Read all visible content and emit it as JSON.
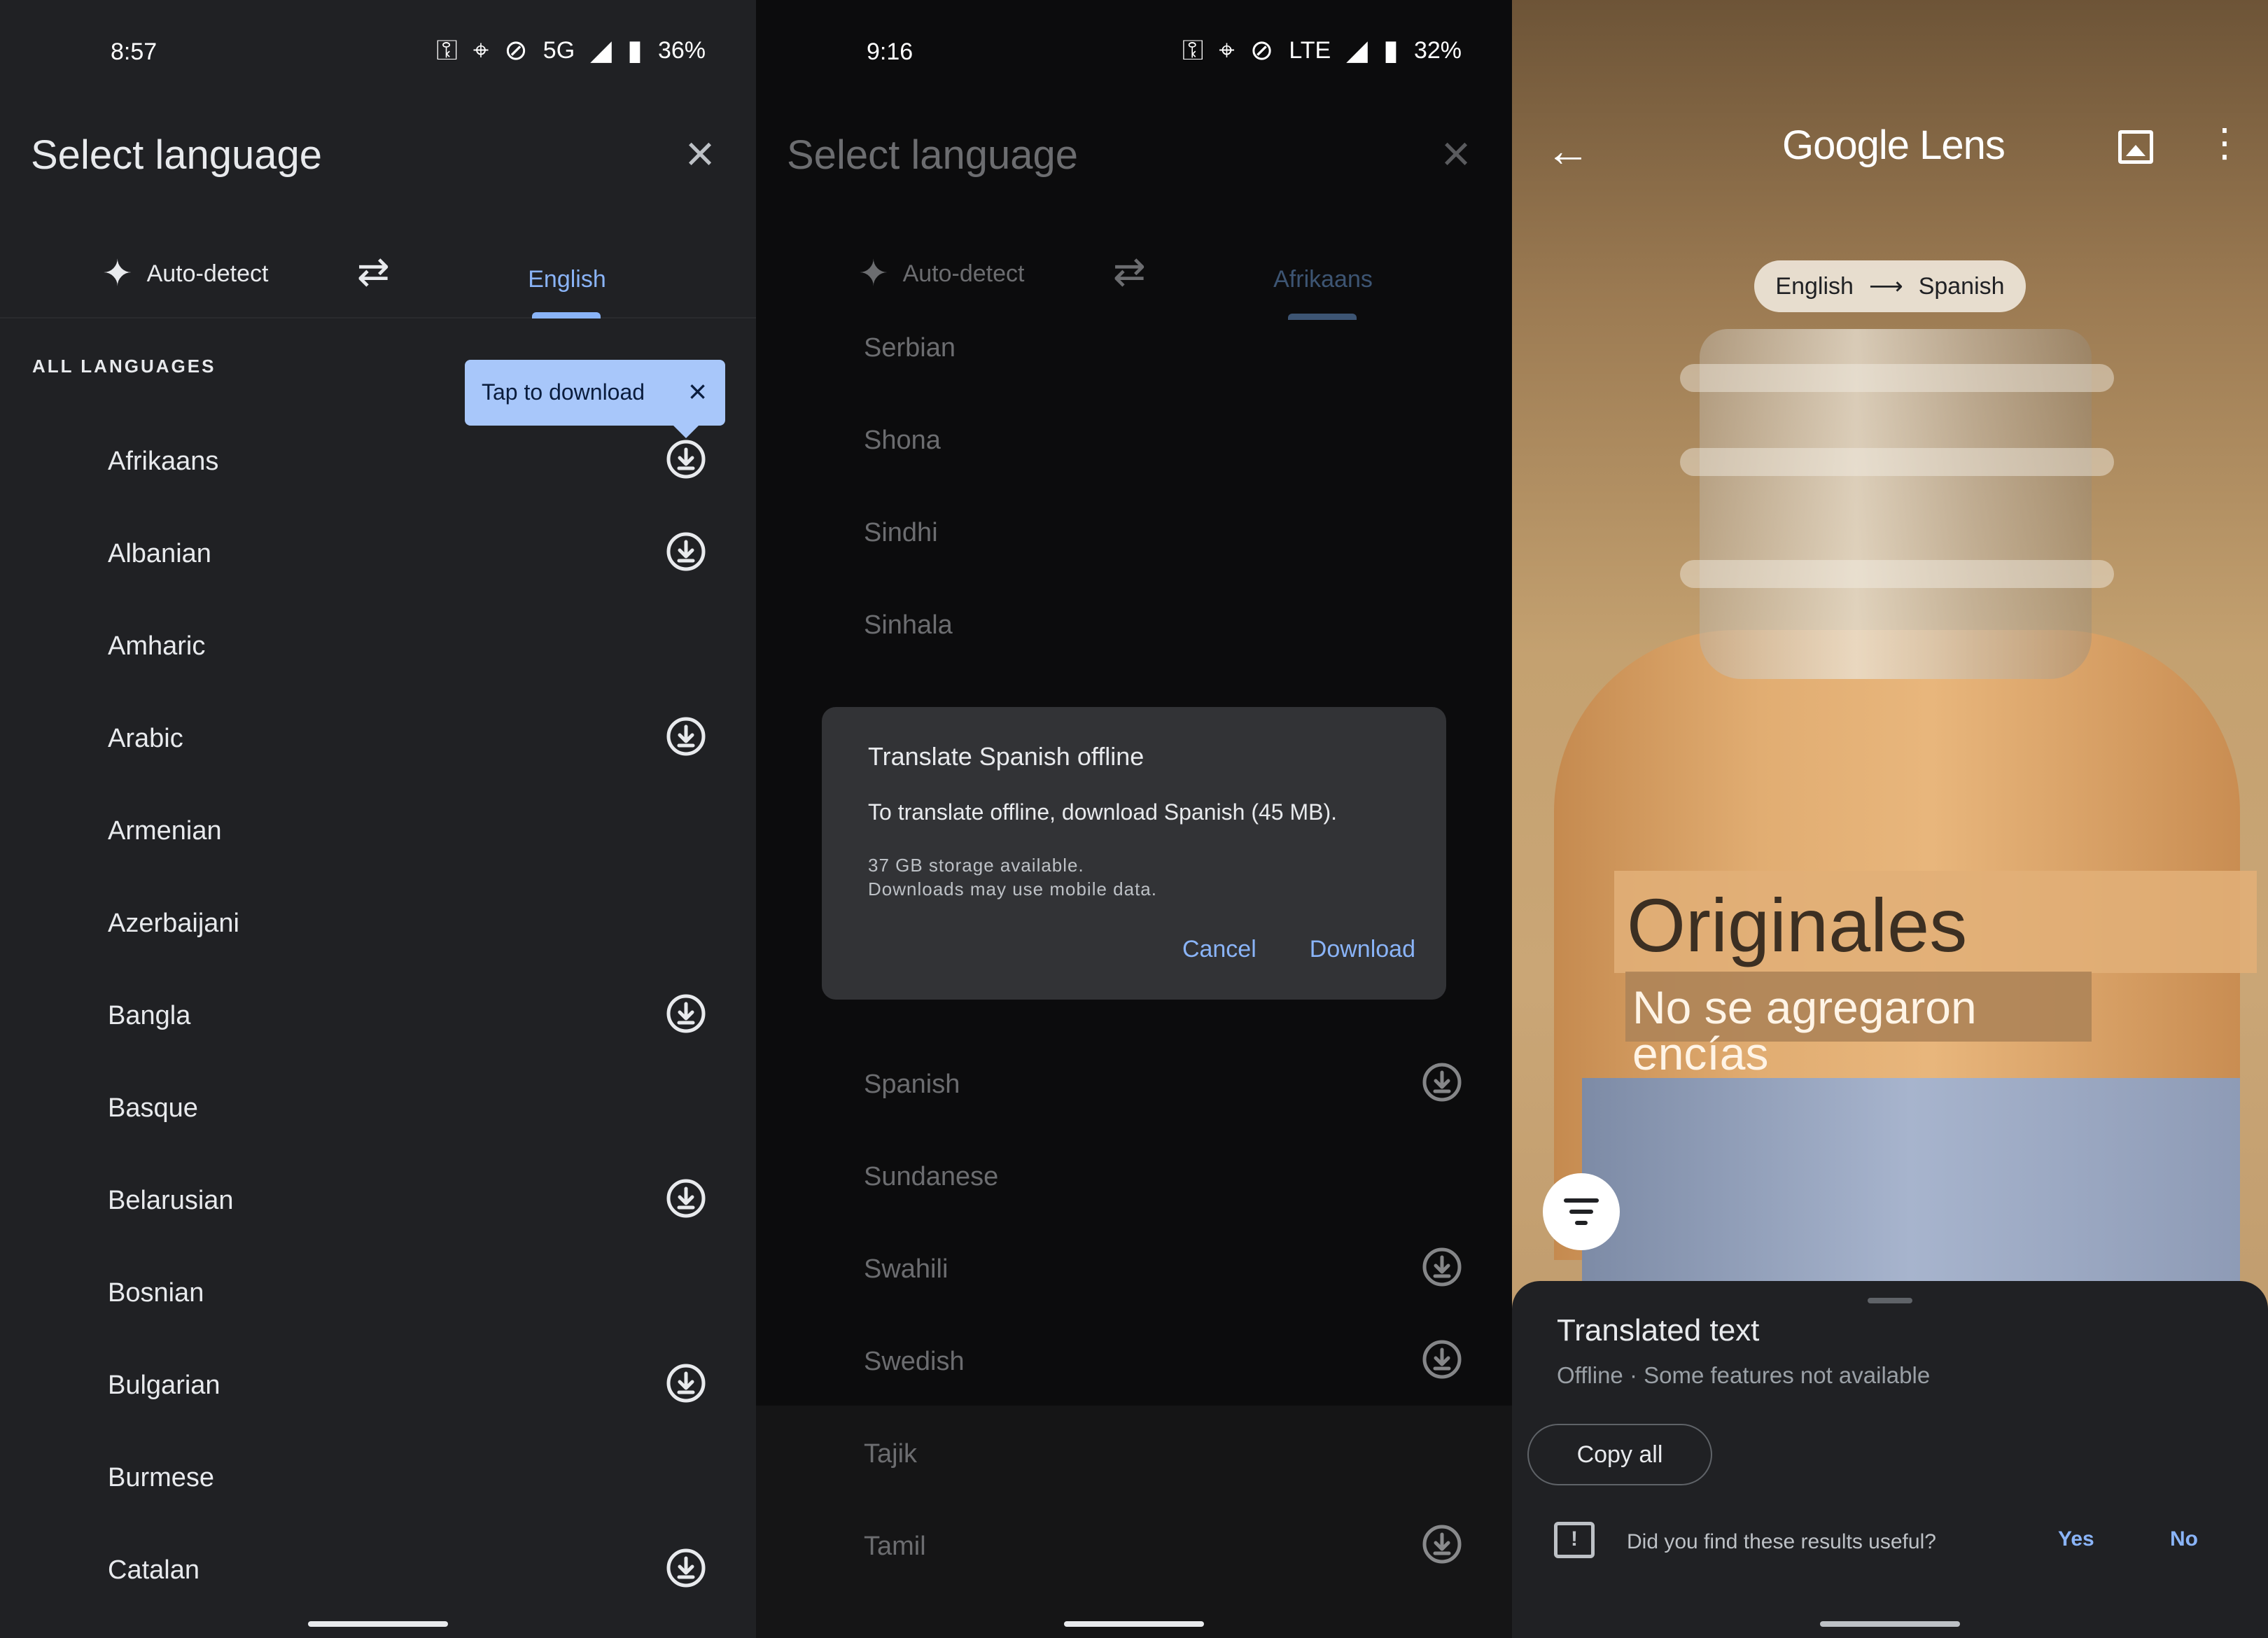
{
  "panel1": {
    "status": {
      "time": "8:57",
      "network": "5G",
      "battery": "36%"
    },
    "title": "Select language",
    "tabs": {
      "auto": "Auto-detect",
      "target": "English"
    },
    "section": "ALL LANGUAGES",
    "tooltip": "Tap to download",
    "languages": [
      {
        "name": "Afrikaans",
        "download": true
      },
      {
        "name": "Albanian",
        "download": true
      },
      {
        "name": "Amharic",
        "download": false
      },
      {
        "name": "Arabic",
        "download": true
      },
      {
        "name": "Armenian",
        "download": false
      },
      {
        "name": "Azerbaijani",
        "download": false
      },
      {
        "name": "Bangla",
        "download": true
      },
      {
        "name": "Basque",
        "download": false
      },
      {
        "name": "Belarusian",
        "download": true
      },
      {
        "name": "Bosnian",
        "download": false
      },
      {
        "name": "Bulgarian",
        "download": true
      },
      {
        "name": "Burmese",
        "download": false
      },
      {
        "name": "Catalan",
        "download": true
      }
    ]
  },
  "panel2": {
    "status": {
      "time": "9:16",
      "network": "LTE",
      "battery": "32%"
    },
    "title": "Select language",
    "tabs": {
      "auto": "Auto-detect",
      "target": "Afrikaans"
    },
    "languages_top": [
      {
        "name": "Serbian",
        "download": false
      },
      {
        "name": "Shona",
        "download": false
      },
      {
        "name": "Sindhi",
        "download": false
      },
      {
        "name": "Sinhala",
        "download": false
      }
    ],
    "languages_bottom": [
      {
        "name": "Spanish",
        "download": true
      },
      {
        "name": "Sundanese",
        "download": false
      },
      {
        "name": "Swahili",
        "download": true
      },
      {
        "name": "Swedish",
        "download": true
      },
      {
        "name": "Tajik",
        "download": false
      },
      {
        "name": "Tamil",
        "download": true
      }
    ],
    "dialog": {
      "title": "Translate Spanish offline",
      "body": "To translate offline, download Spanish (45 MB).",
      "storage": "37 GB storage available.",
      "data_note": "Downloads may use mobile data.",
      "cancel": "Cancel",
      "download": "Download"
    }
  },
  "panel3": {
    "logo_google": "Google",
    "logo_lens": "Lens",
    "from": "English",
    "to": "Spanish",
    "overlay_line1": "Originales",
    "overlay_line2": "No se agregaron encías",
    "sheet": {
      "title": "Translated text",
      "subtitle": "Offline · Some features not available",
      "copy_all": "Copy all",
      "question": "Did you find these results useful?",
      "yes": "Yes",
      "no": "No"
    }
  }
}
